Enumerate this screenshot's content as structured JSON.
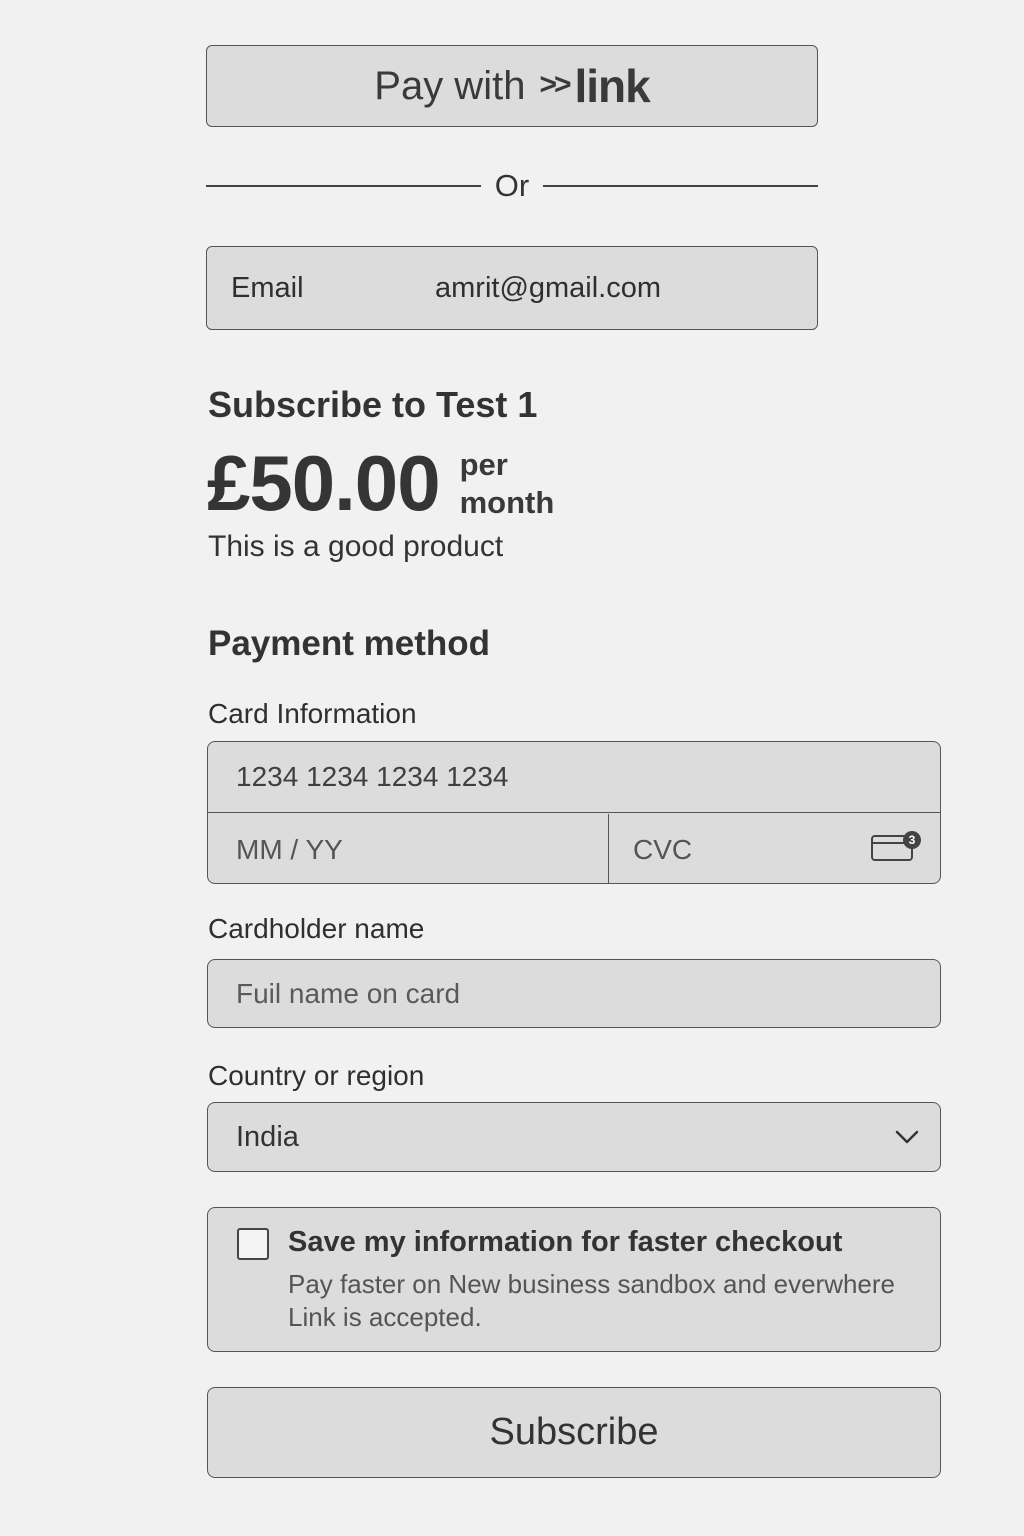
{
  "link_button": {
    "pay_text": "Pay with",
    "mark": ">>",
    "brand": "link"
  },
  "divider": {
    "text": "Or"
  },
  "email": {
    "label": "Email",
    "value": "amrit@gmail.com"
  },
  "product": {
    "title": "Subscribe to Test 1",
    "price": "£50.00",
    "period_line1": "per",
    "period_line2": "month",
    "description": "This is a good product"
  },
  "payment": {
    "title": "Payment method",
    "card_label": "Card Information",
    "card_number_placeholder": "1234 1234 1234 1234",
    "expiry_placeholder": "MM / YY",
    "cvc_placeholder": "CVC",
    "cvc_icon": "card-cvc-icon",
    "cvc_badge": "3",
    "cardholder_label": "Cardholder name",
    "cardholder_placeholder": "Fuil name on card",
    "country_label": "Country or region",
    "country_value": "India",
    "country_icon": "chevron-down-icon"
  },
  "save_info": {
    "title": "Save my information for faster checkout",
    "description": "Pay faster on New business sandbox and everwhere Link is accepted.",
    "checked": false
  },
  "subscribe_button": {
    "label": "Subscribe"
  },
  "colors": {
    "background": "#f1f1f1",
    "field": "#dcdcdc",
    "border": "#555555",
    "text": "#2e2e2e"
  }
}
